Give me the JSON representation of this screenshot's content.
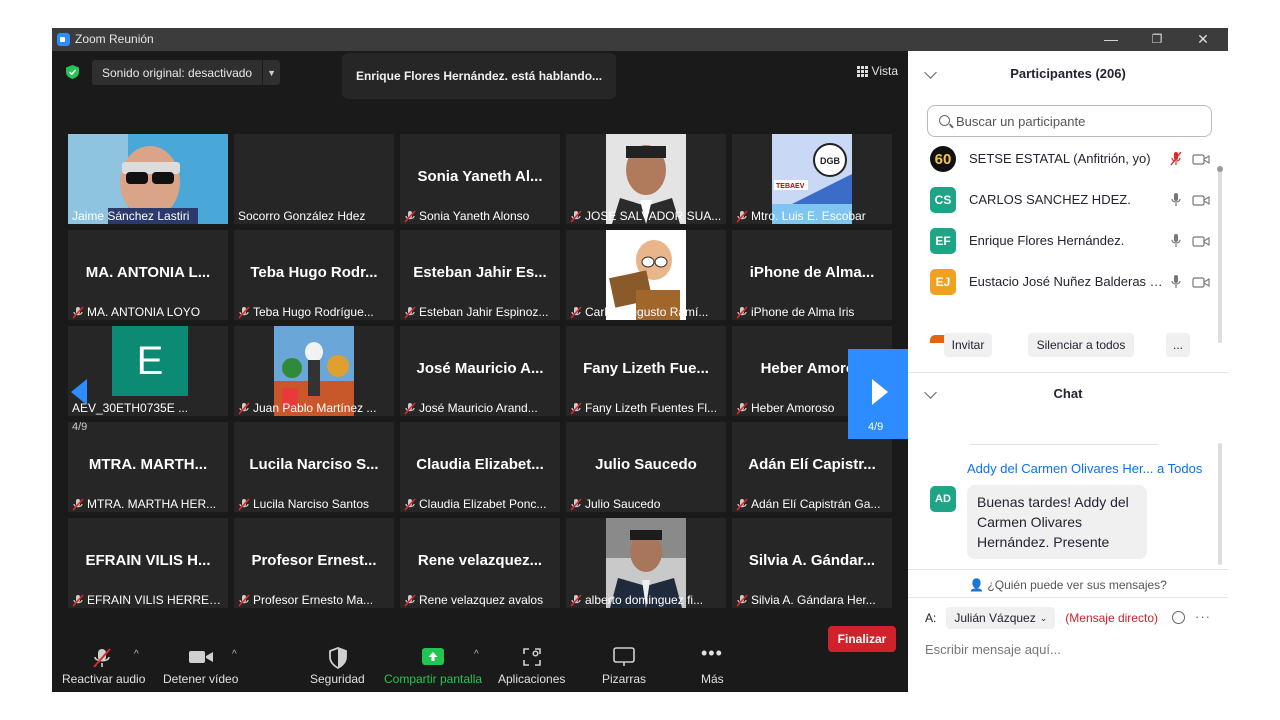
{
  "window": {
    "title": "Zoom Reunión",
    "minimize": "—",
    "restore": "❐",
    "close": "✕"
  },
  "top": {
    "audio_pill": "Sonido original: desactivado",
    "speaking": "Enrique Flores Hernández. está hablando...",
    "view_label": "Vista"
  },
  "grid": {
    "page_left": "4/9",
    "page_right": "4/9",
    "tiles": [
      {
        "big": "",
        "label": "Jaime Sánchez Lastiri",
        "muted": false,
        "photo": "sunglasses-man"
      },
      {
        "big": "",
        "label": "Socorro González Hdez",
        "muted": false
      },
      {
        "big": "Sonia Yaneth Al...",
        "label": "Sonia Yaneth Alonso",
        "muted": true
      },
      {
        "big": "",
        "label": "JOSE SALVADOR SUA...",
        "muted": true,
        "photo": "man-portrait"
      },
      {
        "big": "",
        "label": "Mtro. Luis E. Escobar",
        "muted": true,
        "photo": "dgb-logo"
      },
      {
        "big": "MA. ANTONIA L...",
        "label": "MA. ANTONIA LOYO",
        "muted": true
      },
      {
        "big": "Teba Hugo Rodr...",
        "label": "Teba Hugo Rodrígue...",
        "muted": true
      },
      {
        "big": "Esteban Jahir Es...",
        "label": "Esteban Jahir Espinoz...",
        "muted": true
      },
      {
        "big": "",
        "label": "Carlos Augusto Ramí...",
        "muted": true,
        "photo": "cartoon-reader"
      },
      {
        "big": "iPhone de Alma...",
        "label": "iPhone de Alma Iris",
        "muted": true
      },
      {
        "big": "",
        "label": "AEV_30ETH0735E ...",
        "muted": false,
        "letter": "E"
      },
      {
        "big": "",
        "label": "Juan Pablo Martínez ...",
        "muted": true,
        "photo": "skeleton-scene"
      },
      {
        "big": "José Mauricio A...",
        "label": "José Mauricio Arand...",
        "muted": true
      },
      {
        "big": "Fany Lizeth Fue...",
        "label": "Fany Lizeth Fuentes Fl...",
        "muted": true
      },
      {
        "big": "Heber Amoros",
        "label": "Heber Amoroso",
        "muted": true
      },
      {
        "big": "MTRA. MARTH...",
        "label": "MTRA. MARTHA HER...",
        "muted": true
      },
      {
        "big": "Lucila Narciso S...",
        "label": "Lucila Narciso Santos",
        "muted": true
      },
      {
        "big": "Claudia Elizabet...",
        "label": "Claudia Elizabet Ponc...",
        "muted": true
      },
      {
        "big": "Julio Saucedo",
        "label": "Julio Saucedo",
        "muted": true
      },
      {
        "big": "Adán Elí Capistr...",
        "label": "Adán Elí Capistrán Ga...",
        "muted": true
      },
      {
        "big": "EFRAIN VILIS H...",
        "label": "EFRAIN VILIS HERRERA",
        "muted": true
      },
      {
        "big": "Profesor Ernest...",
        "label": "Profesor Ernesto Ma...",
        "muted": true
      },
      {
        "big": "Rene velazquez...",
        "label": "Rene velazquez avalos",
        "muted": true
      },
      {
        "big": "",
        "label": "alberto dominguez fi...",
        "muted": true,
        "photo": "man-suit"
      },
      {
        "big": "Silvia A. Gándar...",
        "label": "Silvia A. Gándara Her...",
        "muted": true
      }
    ]
  },
  "toolbar": {
    "audio": "Reactivar audio",
    "video": "Detener vídeo",
    "security": "Seguridad",
    "share": "Compartir pantalla",
    "apps": "Aplicaciones",
    "whiteboard": "Pizarras",
    "more": "Más",
    "end": "Finalizar"
  },
  "participants": {
    "header": "Participantes (206)",
    "search_placeholder": "Buscar un participante",
    "list": [
      {
        "initials": "60",
        "name": "SETSE ESTATAL (Anfitrión, yo)",
        "color": "#111111",
        "mic_muted": true
      },
      {
        "initials": "CS",
        "name": "CARLOS SANCHEZ HDEZ.",
        "color": "#1ea586",
        "mic_muted": false
      },
      {
        "initials": "EF",
        "name": "Enrique Flores Hernández.",
        "color": "#1ea586",
        "mic_muted": false
      },
      {
        "initials": "EJ",
        "name": "Eustacio José Nuñez Balderas \"...",
        "color": "#f0a11f",
        "mic_muted": false
      }
    ],
    "invite": "Invitar",
    "mute_all": "Silenciar a todos",
    "more": "..."
  },
  "chat": {
    "header": "Chat",
    "sender": "Addy del Carmen Olivares Her...",
    "recipient": "a Todos",
    "avatar": "AD",
    "message": "Buenas tardes! Addy del Carmen Olivares Hernández. Presente",
    "who_can_see": "¿Quién puede ver sus mensajes?",
    "to_label": "A:",
    "to_value": "Julián Vázquez",
    "direct": "(Mensaje directo)",
    "more": "···",
    "placeholder": "Escribir mensaje aquí..."
  }
}
